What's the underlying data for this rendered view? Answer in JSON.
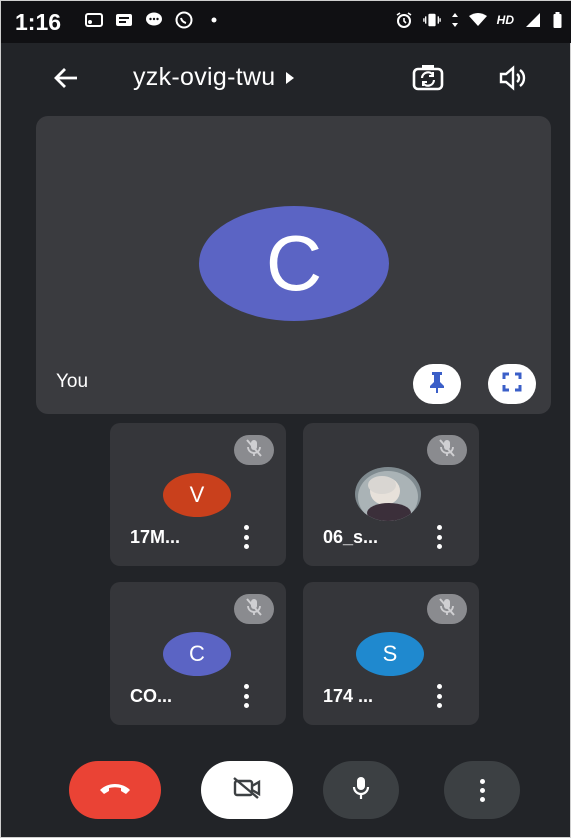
{
  "status_bar": {
    "time": "1:16",
    "hd_label": "HD",
    "left_icons": [
      "cast-icon",
      "message-icon",
      "chat-bubble-icon",
      "whatsapp-icon",
      "dot-icon"
    ],
    "right_icons": [
      "alarm-icon",
      "vibrate-icon",
      "data-arrows-icon",
      "wifi-icon",
      "signal-icon",
      "battery-icon"
    ]
  },
  "header": {
    "meeting_code": "yzk-ovig-twu",
    "icons": [
      "back-arrow-icon",
      "switch-camera-icon",
      "speaker-icon"
    ]
  },
  "self_tile": {
    "avatar_letter": "C",
    "name": "You",
    "avatar_color": "#5b64c4",
    "icons": [
      "pin-icon",
      "fullscreen-icon"
    ]
  },
  "participants": [
    {
      "name": "17M...",
      "avatar_letter": "V",
      "avatar_color": "#c9401c",
      "muted": true
    },
    {
      "name": "06_s...",
      "avatar_letter": "",
      "avatar_color": "#9aa3a8",
      "muted": true,
      "photo": true
    },
    {
      "name": "CO...",
      "avatar_letter": "C",
      "avatar_color": "#5b64c4",
      "muted": true
    },
    {
      "name": "174 ...",
      "avatar_letter": "S",
      "avatar_color": "#1f89cf",
      "muted": true
    }
  ],
  "controls": {
    "end_call_color": "#ea4335",
    "icons": [
      "end-call-icon",
      "camera-off-icon",
      "microphone-icon",
      "more-options-icon"
    ]
  }
}
